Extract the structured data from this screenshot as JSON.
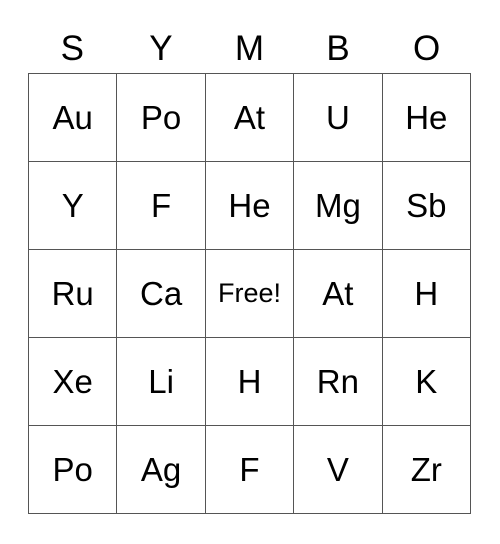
{
  "card": {
    "header_letters": [
      "S",
      "Y",
      "M",
      "B",
      "O"
    ],
    "free_label": "Free!",
    "colors": {
      "border": "#555555",
      "text": "#000000",
      "background": "#ffffff"
    },
    "grid_size": "5x5",
    "rows": [
      {
        "cells": [
          "Au",
          "Po",
          "At",
          "U",
          "He"
        ]
      },
      {
        "cells": [
          "Y",
          "F",
          "He",
          "Mg",
          "Sb"
        ]
      },
      {
        "cells": [
          "Ru",
          "Ca",
          "Free!",
          "At",
          "H"
        ]
      },
      {
        "cells": [
          "Xe",
          "Li",
          "H",
          "Rn",
          "K"
        ]
      },
      {
        "cells": [
          "Po",
          "Ag",
          "F",
          "V",
          "Zr"
        ]
      }
    ]
  }
}
